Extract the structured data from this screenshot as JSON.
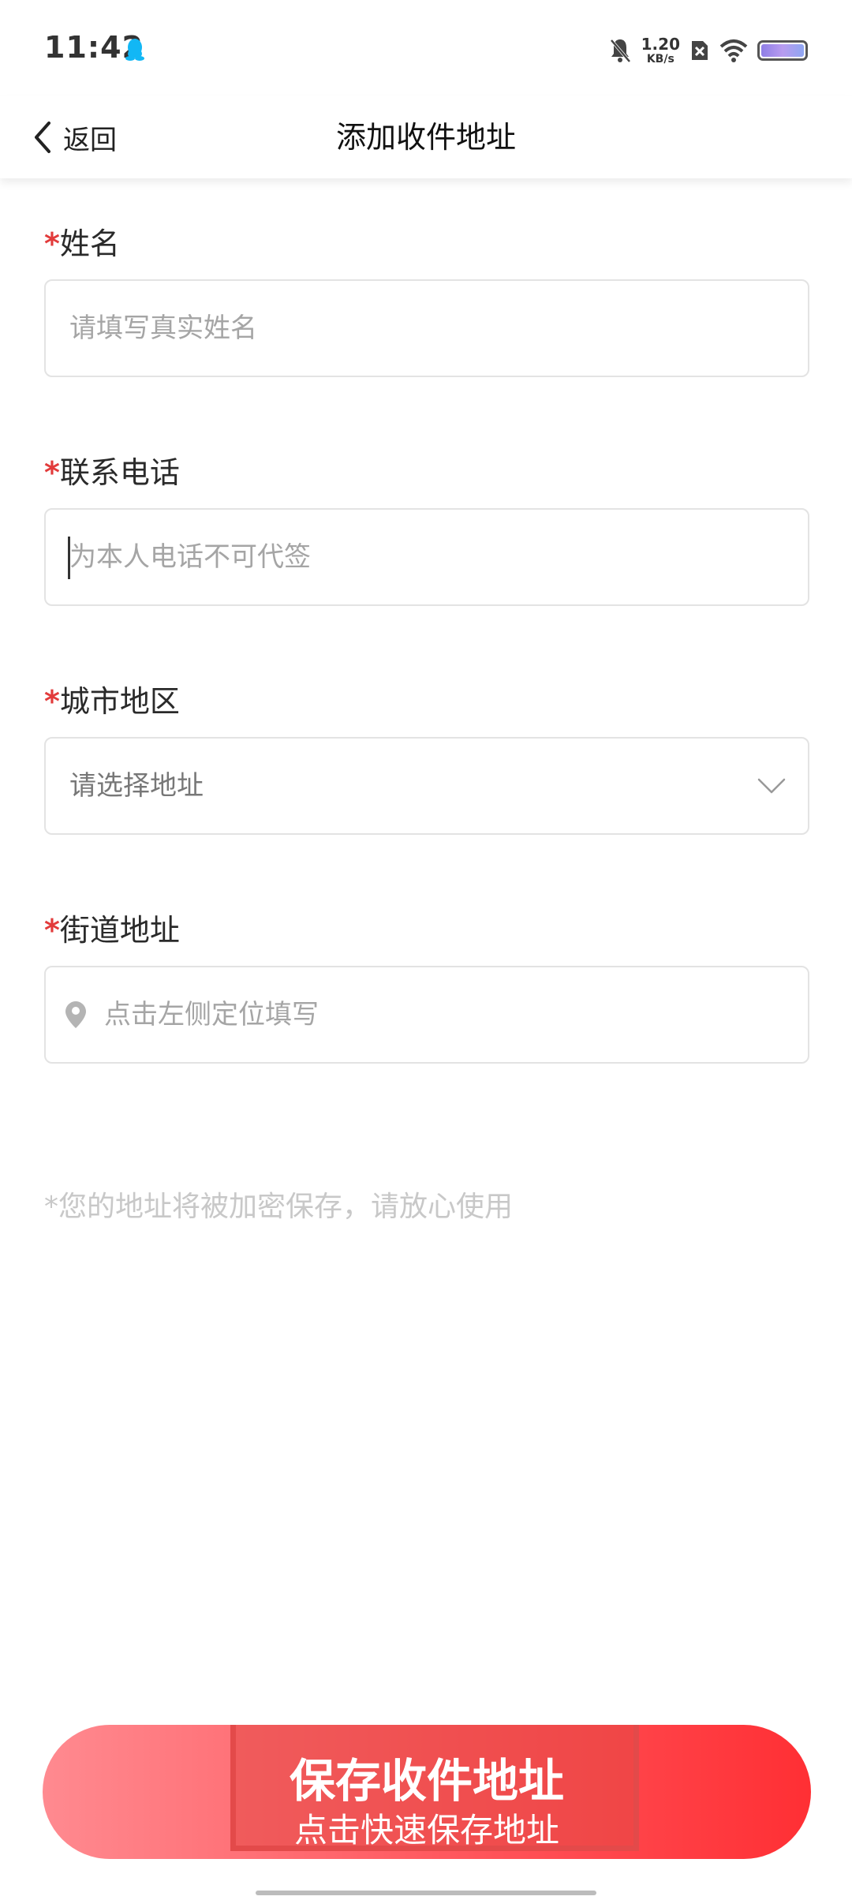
{
  "status_bar": {
    "time": "11:42",
    "net_speed_value": "1.20",
    "net_speed_unit": "KB/s"
  },
  "header": {
    "back_label": "返回",
    "title": "添加收件地址"
  },
  "form": {
    "name": {
      "required_mark": "*",
      "label": "姓名",
      "placeholder": "请填写真实姓名",
      "value": ""
    },
    "phone": {
      "required_mark": "*",
      "label": "联系电话",
      "placeholder": "为本人电话不可代签",
      "value": ""
    },
    "city": {
      "required_mark": "*",
      "label": "城市地区",
      "placeholder": "请选择地址"
    },
    "street": {
      "required_mark": "*",
      "label": "街道地址",
      "placeholder": "点击左侧定位填写",
      "value": ""
    },
    "note": "*您的地址将被加密保存，请放心使用"
  },
  "save_button": {
    "title": "保存收件地址",
    "subtitle": "点击快速保存地址"
  },
  "colors": {
    "required": "#e23b3b",
    "button_start": "#ff8a90",
    "button_end": "#ff2f34"
  },
  "icons": {
    "back": "chevron-left-icon",
    "city_dropdown": "chevron-down-icon",
    "street_locate": "location-pin-icon"
  }
}
